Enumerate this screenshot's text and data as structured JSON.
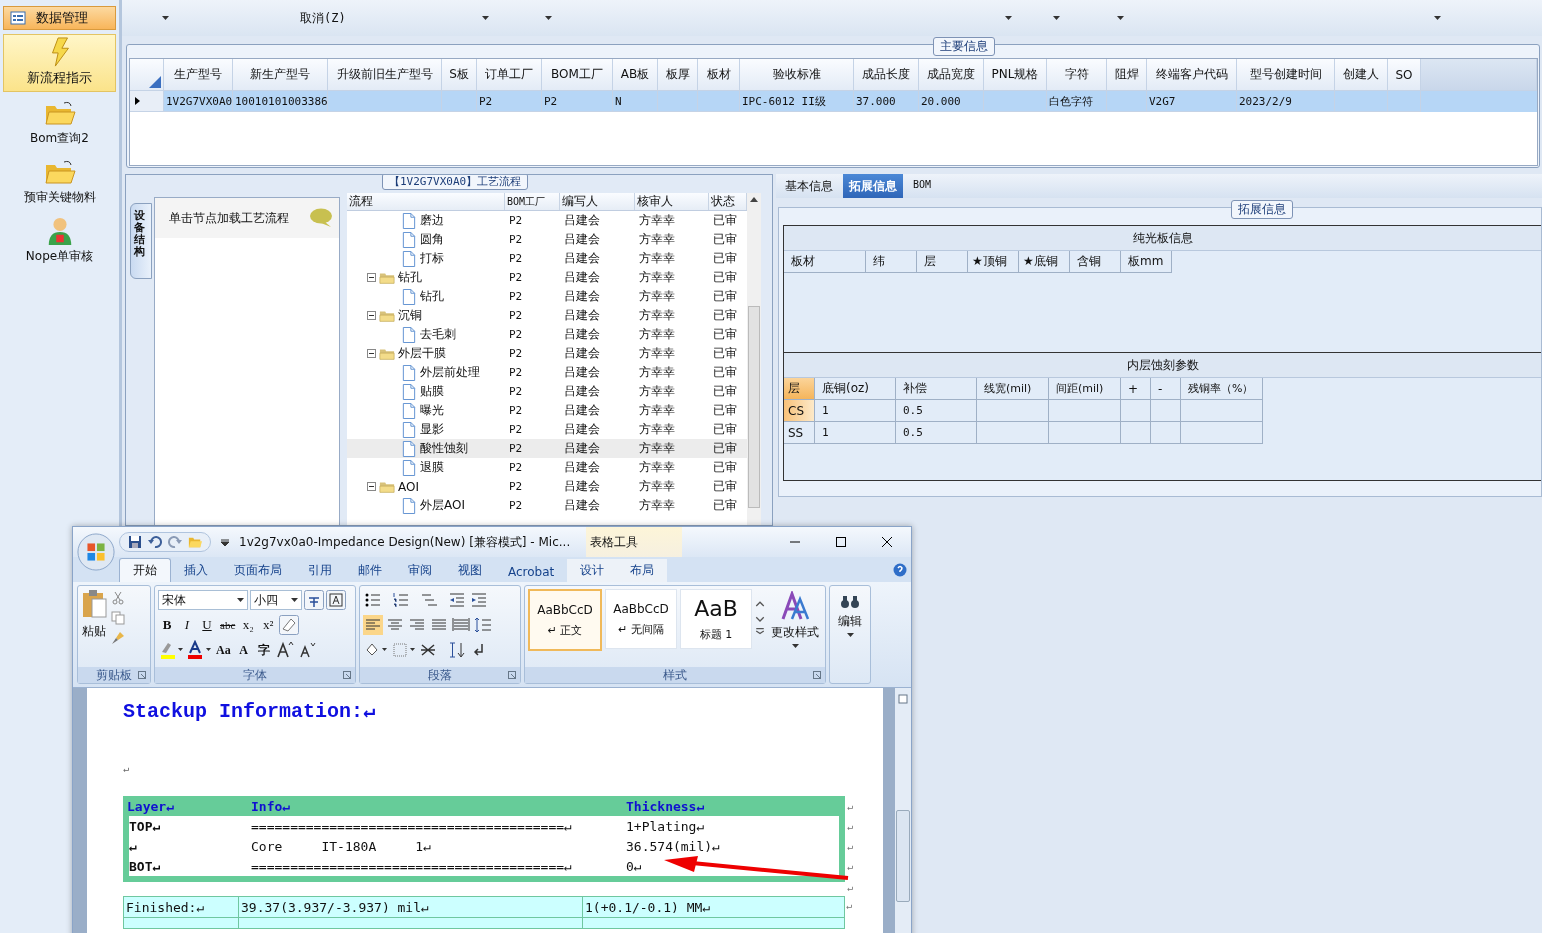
{
  "sidebar": {
    "header": "数据管理",
    "items": [
      {
        "label": "新流程指示",
        "selected": true
      },
      {
        "label": "Bom查询2",
        "selected": false
      },
      {
        "label": "预审关键物料",
        "selected": false
      },
      {
        "label": "Nope单审核",
        "selected": false
      }
    ]
  },
  "toolbar": {
    "items": [
      {
        "kind": "caret"
      },
      {
        "kind": "text",
        "label": "取消(Z)"
      },
      {
        "kind": "caret"
      },
      {
        "kind": "caret"
      },
      {
        "kind": "caret"
      },
      {
        "kind": "caret"
      },
      {
        "kind": "caret"
      },
      {
        "kind": "caret"
      }
    ]
  },
  "main_info": {
    "legend": "主要信息",
    "columns": [
      "生产型号",
      "新生产型号",
      "升级前旧生产型号",
      "S板",
      "订单工厂",
      "BOM工厂",
      "AB板",
      "板厚",
      "板材",
      "验收标准",
      "成品长度",
      "成品宽度",
      "PNL规格",
      "字符",
      "阻焊",
      "终端客户代码",
      "型号创建时间",
      "创建人",
      "SO"
    ],
    "rows": [
      {
        "selected": true,
        "cells": [
          "1V2G7VX0A0",
          "10010101003386",
          null,
          null,
          "P2",
          "P2",
          "N",
          null,
          null,
          "IPC-6012 II级",
          "37.000",
          "20.000",
          null,
          "白色字符",
          null,
          "V2G7",
          "2023/2/9",
          null,
          null
        ]
      }
    ]
  },
  "process_panel": {
    "legend": "【1V2G7VX0A0】工艺流程",
    "side_tab": "设备结构",
    "hint": "单击节点加载工艺流程",
    "columns": [
      "流程",
      "BOM工厂",
      "编写人",
      "核审人",
      "状态"
    ],
    "tree": [
      {
        "kind": "file",
        "name": "磨边",
        "selected": false,
        "cells": [
          "P2",
          "吕建会",
          "方幸幸",
          "已审"
        ]
      },
      {
        "kind": "file",
        "name": "圆角",
        "selected": false,
        "cells": [
          "P2",
          "吕建会",
          "方幸幸",
          "已审"
        ]
      },
      {
        "kind": "file",
        "name": "打标",
        "selected": false,
        "cells": [
          "P2",
          "吕建会",
          "方幸幸",
          "已审"
        ]
      },
      {
        "kind": "folder",
        "name": "钻孔",
        "expanded": true,
        "selected": false,
        "cells": [
          "P2",
          "吕建会",
          "方幸幸",
          "已审"
        ],
        "children": [
          {
            "kind": "file",
            "name": "钻孔",
            "selected": false,
            "cells": [
              "P2",
              "吕建会",
              "方幸幸",
              "已审"
            ]
          }
        ]
      },
      {
        "kind": "folder",
        "name": "沉铜",
        "expanded": true,
        "selected": false,
        "cells": [
          "P2",
          "吕建会",
          "方幸幸",
          "已审"
        ],
        "children": [
          {
            "kind": "file",
            "name": "去毛刺",
            "selected": false,
            "cells": [
              "P2",
              "吕建会",
              "方幸幸",
              "已审"
            ]
          }
        ]
      },
      {
        "kind": "folder",
        "name": "外层干膜",
        "expanded": true,
        "selected": false,
        "cells": [
          "P2",
          "吕建会",
          "方幸幸",
          "已审"
        ],
        "children": [
          {
            "kind": "file",
            "name": "外层前处理",
            "selected": false,
            "cells": [
              "P2",
              "吕建会",
              "方幸幸",
              "已审"
            ]
          },
          {
            "kind": "file",
            "name": "贴膜",
            "selected": false,
            "cells": [
              "P2",
              "吕建会",
              "方幸幸",
              "已审"
            ]
          },
          {
            "kind": "file",
            "name": "曝光",
            "selected": false,
            "cells": [
              "P2",
              "吕建会",
              "方幸幸",
              "已审"
            ]
          },
          {
            "kind": "file",
            "name": "显影",
            "selected": false,
            "cells": [
              "P2",
              "吕建会",
              "方幸幸",
              "已审"
            ]
          },
          {
            "kind": "file",
            "name": "酸性蚀刻",
            "selected": true,
            "cells": [
              "P2",
              "吕建会",
              "方幸幸",
              "已审"
            ]
          },
          {
            "kind": "file",
            "name": "退膜",
            "selected": false,
            "cells": [
              "P2",
              "吕建会",
              "方幸幸",
              "已审"
            ]
          }
        ]
      },
      {
        "kind": "folder",
        "name": "AOI",
        "expanded": true,
        "selected": false,
        "cells": [
          "P2",
          "吕建会",
          "方幸幸",
          "已审"
        ],
        "children": [
          {
            "kind": "file",
            "name": "外层AOI",
            "selected": false,
            "cells": [
              "P2",
              "吕建会",
              "方幸幸",
              "已审"
            ]
          }
        ]
      }
    ]
  },
  "right_panel": {
    "tabs": [
      {
        "label": "基本信息",
        "selected": false
      },
      {
        "label": "拓展信息",
        "selected": true
      },
      {
        "label": "BOM",
        "selected": false
      }
    ],
    "legend": "拓展信息",
    "bare_board": {
      "title": "纯光板信息",
      "columns": [
        "板材",
        "纬",
        "层",
        "★顶铜",
        "★底铜",
        "含铜",
        "板mm"
      ]
    },
    "inner_etch": {
      "title": "内层蚀刻参数",
      "columns": [
        "层",
        "底铜(oz)",
        "补偿",
        "线宽(mil)",
        "间距(mil)",
        "+",
        "-",
        "残铜率（%）"
      ],
      "rows": [
        {
          "selected": true,
          "cells": [
            "CS",
            "1",
            "0.5",
            null,
            null,
            null,
            null,
            null
          ]
        },
        {
          "selected": false,
          "cells": [
            "SS",
            "1",
            "0.5",
            null,
            null,
            null,
            null,
            null
          ]
        }
      ]
    }
  },
  "word": {
    "title": "1v2g7vx0a0-Impedance Design(New) [兼容模式] - Mic...",
    "context_tab": "表格工具",
    "tabs": [
      {
        "label": "开始",
        "selected": true
      },
      {
        "label": "插入",
        "selected": false
      },
      {
        "label": "页面布局",
        "selected": false
      },
      {
        "label": "引用",
        "selected": false
      },
      {
        "label": "邮件",
        "selected": false
      },
      {
        "label": "审阅",
        "selected": false
      },
      {
        "label": "视图",
        "selected": false
      },
      {
        "label": "Acrobat",
        "selected": false
      },
      {
        "label": "设计",
        "selected": false
      },
      {
        "label": "布局",
        "selected": false
      }
    ],
    "ribbon": {
      "clipboard": {
        "label": "剪贴板",
        "paste": "粘贴"
      },
      "font": {
        "label": "字体",
        "name": "宋体",
        "size": "小四",
        "buttons": [
          "B",
          "I",
          "U",
          "abc",
          "x₂",
          "x²"
        ],
        "buttons2": [
          "Aa",
          "A",
          "字"
        ]
      },
      "paragraph": {
        "label": "段落"
      },
      "styles": {
        "label": "样式",
        "gallery": [
          {
            "sample": "AaBbCcD",
            "name": "↵ 正文",
            "selected": true
          },
          {
            "sample": "AaBbCcD",
            "name": "↵ 无间隔",
            "selected": false
          },
          {
            "sample": "AaB",
            "name": "标题 1",
            "selected": false
          }
        ],
        "change": "更改样式"
      },
      "editing": {
        "label": "编辑"
      }
    },
    "document": {
      "heading": "Stackup Information:↵",
      "blank": "↵",
      "stack_header": [
        "Layer↵",
        "Info↵",
        "Thickness↵"
      ],
      "stack_rows": [
        {
          "cells": [
            "TOP↵",
            "========================================↵",
            "1+Plating↵"
          ],
          "end": "↵"
        },
        {
          "cells": [
            "↵",
            "Core     IT-180A     1↵",
            "36.574(mil)↵"
          ],
          "end": "↵"
        },
        {
          "cells": [
            "BOT↵",
            "========================================↵",
            "0↵"
          ],
          "end": "↵"
        }
      ],
      "header_end": "↵",
      "after_table": "↵",
      "finished": {
        "cells": [
          "Finished:↵",
          "39.37(3.937/-3.937) mil↵",
          "1(+0.1/-0.1) MM↵"
        ],
        "end": "↵"
      }
    }
  }
}
